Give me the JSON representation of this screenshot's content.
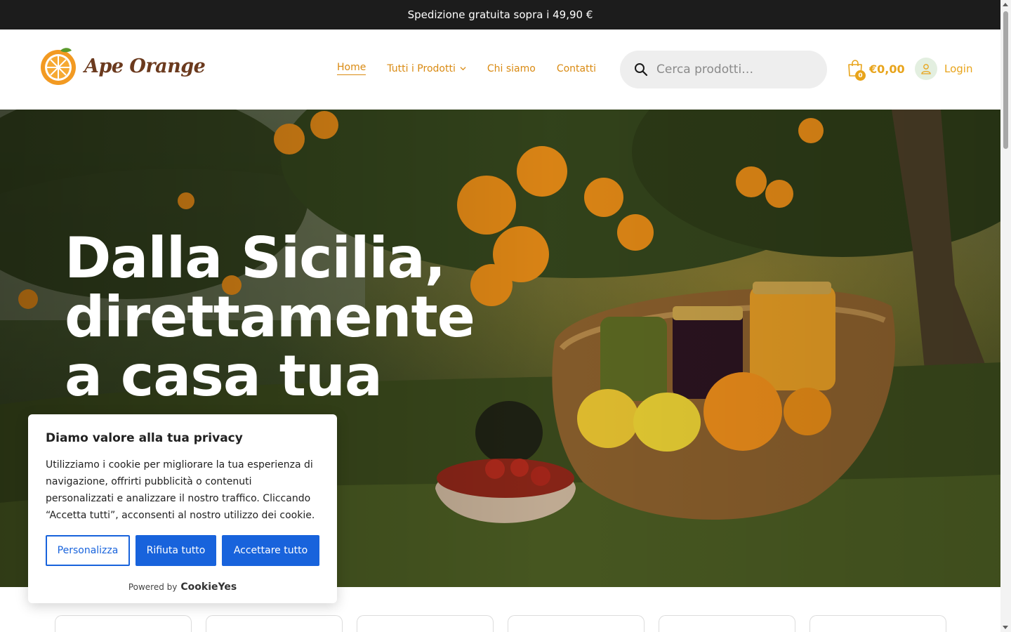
{
  "announcement": {
    "text": "Spedizione gratuita sopra i 49,90 €"
  },
  "brand": {
    "name": "Ape Orange",
    "logo_icon": "orange-slice-icon",
    "color": "#6b3a1e"
  },
  "nav": {
    "items": [
      {
        "label": "Home",
        "active": true
      },
      {
        "label": "Tutti i Prodotti",
        "has_dropdown": true
      },
      {
        "label": "Chi siamo"
      },
      {
        "label": "Contatti"
      }
    ],
    "accent": "#d98a12"
  },
  "search": {
    "placeholder": "Cerca prodotti…",
    "icon": "search-icon"
  },
  "cart": {
    "count": "0",
    "total": "€0,00",
    "icon": "shopping-bag-icon"
  },
  "account": {
    "label": "Login",
    "icon": "user-icon"
  },
  "hero": {
    "title_lines": [
      "Dalla Sicilia,",
      "direttamente",
      "a casa tua"
    ]
  },
  "cookie_banner": {
    "title": "Diamo valore alla tua privacy",
    "text": "Utilizziamo i cookie per migliorare la tua esperienza di navigazione, offrirti pubblicità o contenuti personalizzati e analizzare il nostro traffico. Cliccando “Accetta tutti”, acconsenti al nostro utilizzo dei cookie.",
    "buttons": {
      "customize": "Personalizza",
      "reject": "Rifiuta tutto",
      "accept": "Accettare tutto"
    },
    "powered_by": "Powered by",
    "powered_brand": "CookieYes",
    "button_color": "#1863dc"
  }
}
